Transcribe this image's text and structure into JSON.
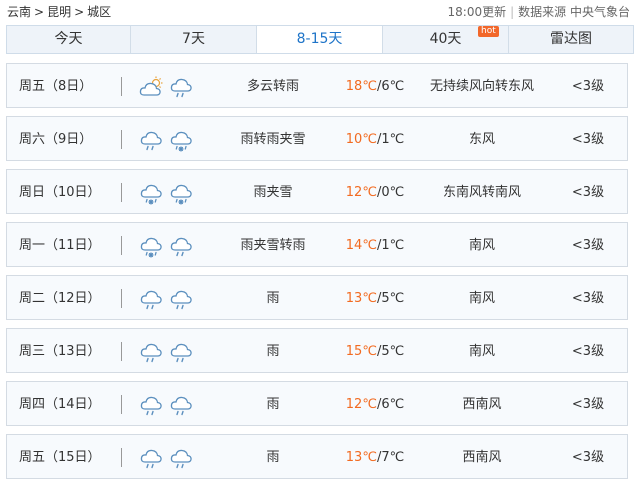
{
  "breadcrumb": {
    "province": "云南",
    "city": "昆明",
    "district": "城区",
    "sep": ">"
  },
  "update": {
    "time": "18:00更新",
    "sep": "|",
    "source": "数据来源 中央气象台"
  },
  "tabs": [
    {
      "label": "今天"
    },
    {
      "label": "7天"
    },
    {
      "label": "8-15天",
      "active": true
    },
    {
      "label": "40天",
      "badge": "hot"
    },
    {
      "label": "雷达图"
    }
  ],
  "colors": {
    "accent": "#1e74c8",
    "high_temp": "#f26b21",
    "hot_badge": "#f2672a",
    "icon_stroke": "#5b8fbe"
  },
  "forecast": [
    {
      "day": "周五（8日）",
      "icons": [
        "partly-cloudy-icon",
        "rain-icon"
      ],
      "desc": "多云转雨",
      "high": "18℃",
      "low": "/6℃",
      "wind": "无持续风向转东风",
      "level": "<3级"
    },
    {
      "day": "周六（9日）",
      "icons": [
        "rain-icon",
        "sleet-icon"
      ],
      "desc": "雨转雨夹雪",
      "high": "10℃",
      "low": "/1℃",
      "wind": "东风",
      "level": "<3级"
    },
    {
      "day": "周日（10日）",
      "icons": [
        "sleet-icon",
        "sleet-icon"
      ],
      "desc": "雨夹雪",
      "high": "12℃",
      "low": "/0℃",
      "wind": "东南风转南风",
      "level": "<3级"
    },
    {
      "day": "周一（11日）",
      "icons": [
        "sleet-icon",
        "rain-icon"
      ],
      "desc": "雨夹雪转雨",
      "high": "14℃",
      "low": "/1℃",
      "wind": "南风",
      "level": "<3级"
    },
    {
      "day": "周二（12日）",
      "icons": [
        "rain-icon",
        "rain-icon"
      ],
      "desc": "雨",
      "high": "13℃",
      "low": "/5℃",
      "wind": "南风",
      "level": "<3级"
    },
    {
      "day": "周三（13日）",
      "icons": [
        "rain-icon",
        "rain-icon"
      ],
      "desc": "雨",
      "high": "15℃",
      "low": "/5℃",
      "wind": "南风",
      "level": "<3级"
    },
    {
      "day": "周四（14日）",
      "icons": [
        "rain-icon",
        "rain-icon"
      ],
      "desc": "雨",
      "high": "12℃",
      "low": "/6℃",
      "wind": "西南风",
      "level": "<3级"
    },
    {
      "day": "周五（15日）",
      "icons": [
        "rain-icon",
        "rain-icon"
      ],
      "desc": "雨",
      "high": "13℃",
      "low": "/7℃",
      "wind": "西南风",
      "level": "<3级"
    }
  ]
}
